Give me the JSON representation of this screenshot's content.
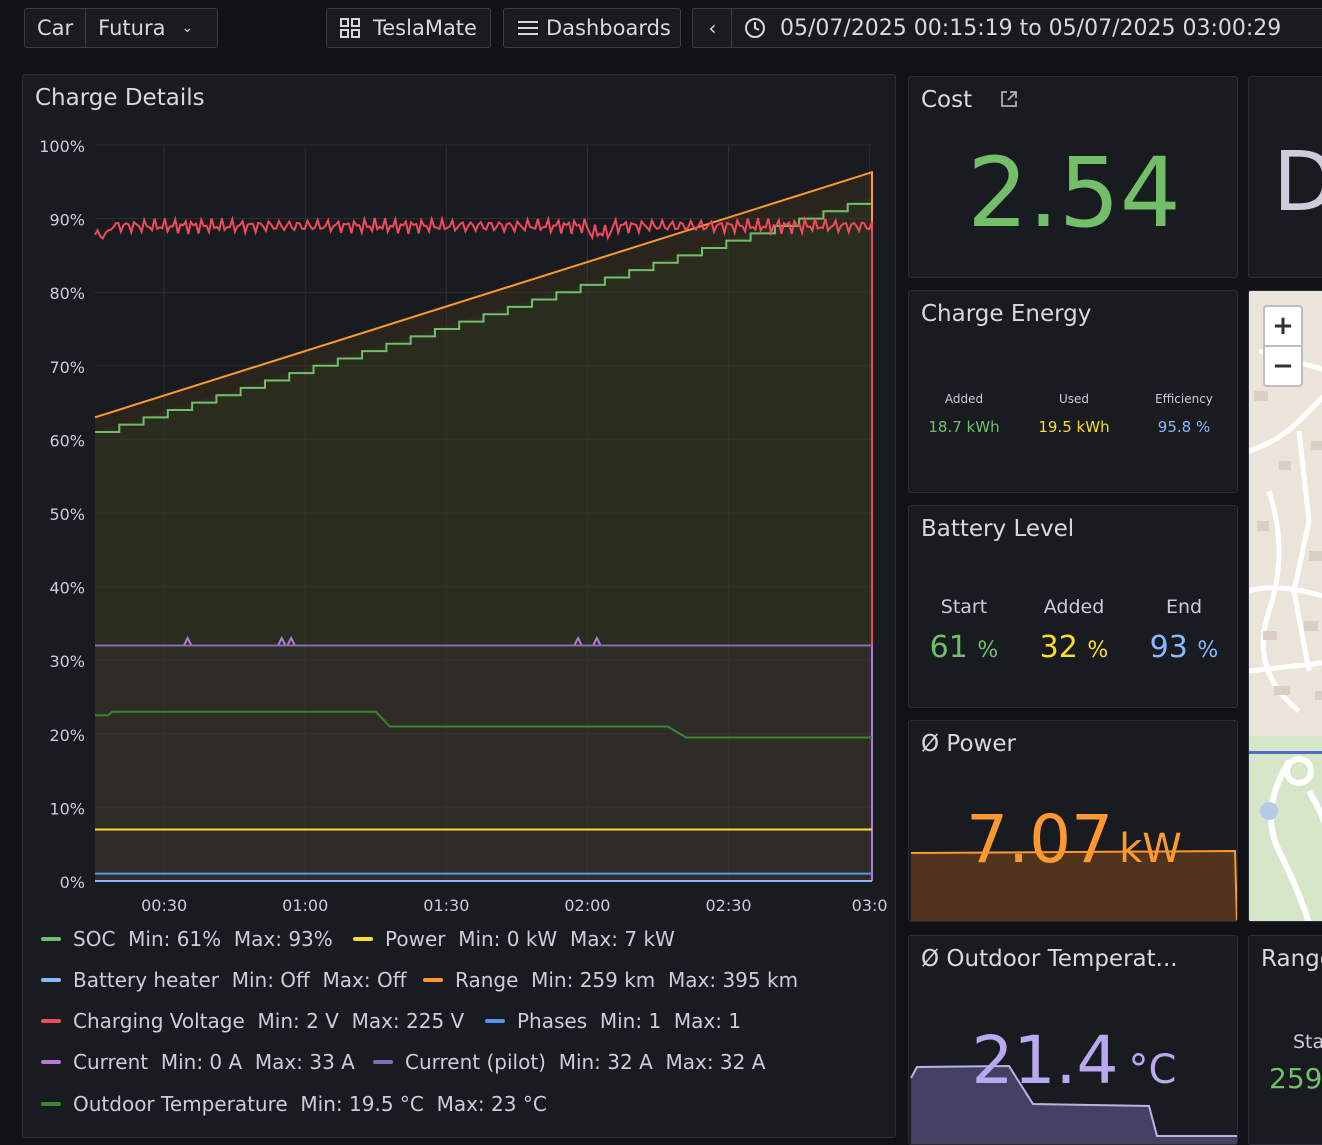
{
  "header": {
    "car_label": "Car",
    "car_value": "Futura",
    "teslamate_label": "TeslaMate",
    "dashboards_label": "Dashboards",
    "time_range": "05/07/2025 00:15:19 to 05/07/2025 03:00:29"
  },
  "charge_details": {
    "title": "Charge Details",
    "legend": [
      {
        "label": "SOC",
        "min": "Min: 61%",
        "max": "Max: 93%",
        "color": "#73bf69"
      },
      {
        "label": "Power",
        "min": "Min: 0 kW",
        "max": "Max: 7 kW",
        "color": "#fade2a"
      },
      {
        "label": "Battery heater",
        "min": "Min: Off",
        "max": "Max: Off",
        "color": "#8ab8ff"
      },
      {
        "label": "Range",
        "min": "Min: 259 km",
        "max": "Max: 395 km",
        "color": "#ff9830"
      },
      {
        "label": "Charging Voltage",
        "min": "Min: 2 V",
        "max": "Max: 225 V",
        "color": "#f2495c"
      },
      {
        "label": "Phases",
        "min": "Min: 1",
        "max": "Max: 1",
        "color": "#5794f2"
      },
      {
        "label": "Current",
        "min": "Min: 0 A",
        "max": "Max: 33 A",
        "color": "#b877d9"
      },
      {
        "label": "Current (pilot)",
        "min": "Min: 32 A",
        "max": "Max: 32 A",
        "color": "#806eb7"
      },
      {
        "label": "Outdoor Temperature",
        "min": "Min: 19.5 °C",
        "max": "Max: 23 °C",
        "color": "#37872d"
      }
    ]
  },
  "chart_data": {
    "type": "line",
    "title": "Charge Details",
    "y_ticks": [
      "0%",
      "10%",
      "20%",
      "30%",
      "40%",
      "50%",
      "60%",
      "70%",
      "80%",
      "90%",
      "100%"
    ],
    "x_ticks": [
      "00:30",
      "01:00",
      "01:30",
      "02:00",
      "02:30",
      "03:0"
    ],
    "x_tick_minutes": [
      30,
      60,
      90,
      120,
      150,
      180
    ],
    "x_range_minutes": [
      15.3,
      180.5
    ],
    "ylim": [
      0,
      100
    ],
    "grid": true,
    "series": [
      {
        "name": "SOC",
        "color": "#73bf69",
        "x": [
          15.3,
          180.5
        ],
        "y": [
          61,
          93
        ]
      },
      {
        "name": "Range",
        "color": "#ff9830",
        "x": [
          15.3,
          180.5
        ],
        "y": [
          63,
          96.3
        ]
      },
      {
        "name": "Charging Voltage",
        "color": "#f2495c",
        "x": [
          15.3,
          180.5
        ],
        "y": [
          89,
          89
        ]
      },
      {
        "name": "Current",
        "color": "#b877d9",
        "x": [
          15.3,
          180.5
        ],
        "y": [
          32,
          32
        ]
      },
      {
        "name": "Current (pilot)",
        "color": "#806eb7",
        "x": [
          15.3,
          180.5
        ],
        "y": [
          32,
          32
        ]
      },
      {
        "name": "Outdoor Temperature",
        "color": "#37872d",
        "x": [
          15.3,
          18,
          19,
          75,
          78,
          137,
          141,
          180.5
        ],
        "y": [
          22.5,
          22.5,
          23,
          23,
          21,
          21,
          19.5,
          19.5
        ]
      },
      {
        "name": "Power",
        "color": "#fade2a",
        "x": [
          15.3,
          180.5
        ],
        "y": [
          7,
          7
        ]
      },
      {
        "name": "Battery heater",
        "color": "#8ab8ff",
        "x": [
          15.3,
          180.5
        ],
        "y": [
          0,
          0
        ]
      },
      {
        "name": "Phases",
        "color": "#5794f2",
        "x": [
          15.3,
          180.5
        ],
        "y": [
          1,
          1
        ]
      }
    ]
  },
  "cost": {
    "title": "Cost",
    "value": "2.54"
  },
  "partial_panel": {
    "letter": "D"
  },
  "charge_energy": {
    "title": "Charge Energy",
    "items": [
      {
        "label": "Added",
        "value": "18.7 kWh",
        "color": "#73bf69"
      },
      {
        "label": "Used",
        "value": "19.5 kWh",
        "color": "#fade2a"
      },
      {
        "label": "Efficiency",
        "value": "95.8 %",
        "color": "#8ab8ff"
      }
    ]
  },
  "battery_level": {
    "title": "Battery Level",
    "items": [
      {
        "label": "Start",
        "value": "61",
        "unit": "%",
        "color": "#73bf69"
      },
      {
        "label": "Added",
        "value": "32",
        "unit": "%",
        "color": "#fade2a"
      },
      {
        "label": "End",
        "value": "93",
        "unit": "%",
        "color": "#8ab8ff"
      }
    ]
  },
  "power": {
    "title": "Ø Power",
    "value": "7.07",
    "unit": "kW"
  },
  "outdoor_temp": {
    "title": "Ø Outdoor Temperat...",
    "value": "21.4",
    "unit": "°C"
  },
  "range_panel": {
    "title": "Range",
    "start_label": "Sta",
    "start_value": "259"
  },
  "map": {
    "zoom_in": "+",
    "zoom_out": "−"
  }
}
